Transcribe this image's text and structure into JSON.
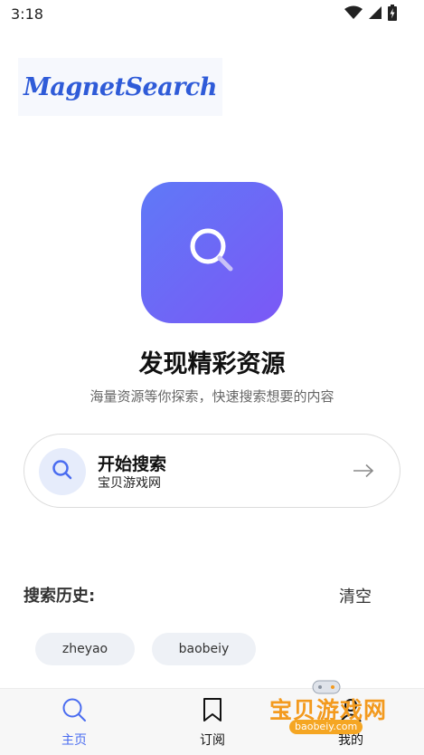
{
  "status_bar": {
    "time": "3:18",
    "icons": [
      "wifi-icon",
      "signal-icon",
      "battery-charging-icon"
    ]
  },
  "logo": {
    "text": "MagnetSearch"
  },
  "hero": {
    "icon": "search-icon",
    "title": "发现精彩资源",
    "subtitle": "海量资源等你探索，快速搜索想要的内容"
  },
  "search": {
    "title": "开始搜索",
    "value": "宝贝游戏网",
    "icon": "search-icon",
    "arrow_icon": "arrow-right-icon"
  },
  "history": {
    "label": "搜索历史:",
    "clear_label": "清空",
    "items": [
      "zheyao",
      "baobeiy"
    ]
  },
  "nav": {
    "items": [
      {
        "label": "主页",
        "icon": "search-icon",
        "active": true
      },
      {
        "label": "订阅",
        "icon": "bookmark-icon",
        "active": false
      },
      {
        "label": "我的",
        "icon": "user-icon",
        "active": false
      }
    ]
  },
  "watermark": {
    "text": "宝贝游戏网",
    "url": "baobeiy.com"
  },
  "colors": {
    "accent": "#4a6cf0",
    "gradient_start": "#5f79f7",
    "gradient_end": "#7b58f6",
    "watermark": "#f39a1e"
  }
}
